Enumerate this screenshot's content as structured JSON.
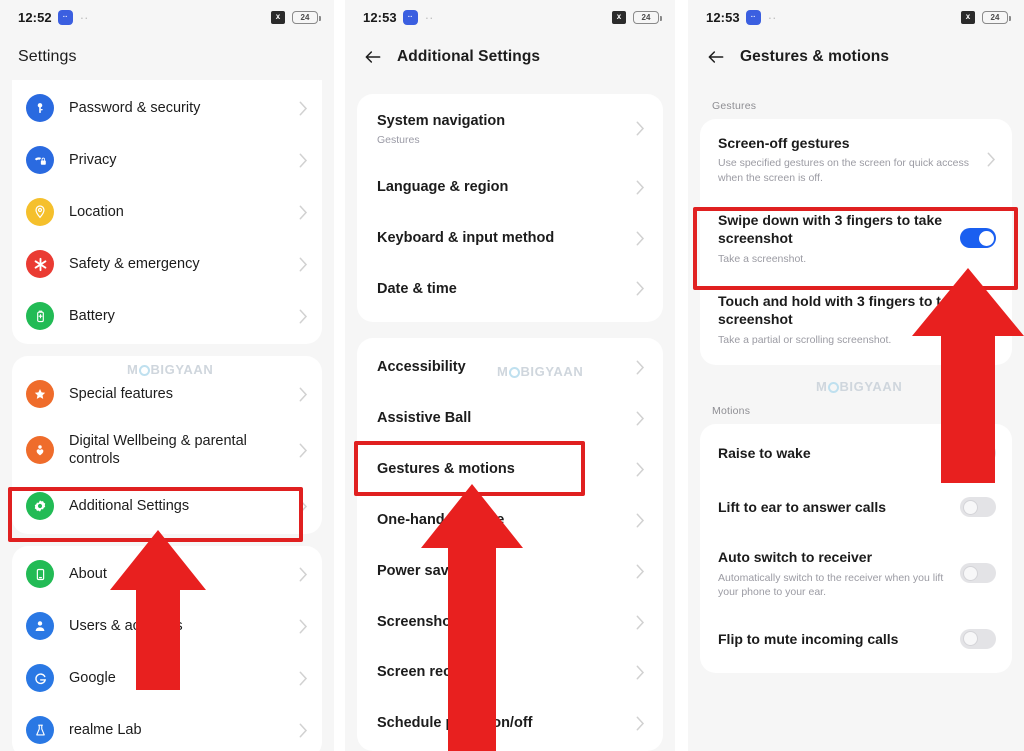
{
  "meta": {
    "watermark_text_parts": [
      "M",
      "BIGYAAN"
    ],
    "accent_red": "#e02020",
    "toggle_on_color": "#1a5ff0"
  },
  "panel1": {
    "status": {
      "time": "12:52",
      "badge_glyph": "··",
      "dash": "··",
      "silent_icon": "x",
      "battery": "24"
    },
    "title": "Settings",
    "group1": [
      {
        "label": "Password & security",
        "icon": "key-icon",
        "color": "#2a6ae0"
      },
      {
        "label": "Privacy",
        "icon": "privacy-hand-icon",
        "color": "#2a6ae0"
      },
      {
        "label": "Location",
        "icon": "location-pin-icon",
        "color": "#f5c02c"
      },
      {
        "label": "Safety & emergency",
        "icon": "asterisk-sos-icon",
        "color": "#ea3b33"
      },
      {
        "label": "Battery",
        "icon": "battery-icon",
        "color": "#22bb55"
      }
    ],
    "group2": [
      {
        "label": "Special features",
        "icon": "star-icon",
        "color": "#ef6c2b"
      },
      {
        "label": "Digital Wellbeing & parental controls",
        "icon": "wellbeing-person-icon",
        "color": "#ef6c2b"
      },
      {
        "label": "Additional Settings",
        "icon": "gear-icon",
        "color": "#22bb55"
      }
    ],
    "group3": [
      {
        "label": "About",
        "icon": "phone-icon",
        "color": "#22bb55"
      },
      {
        "label": "Users & accounts",
        "icon": "person-icon",
        "color": "#2a78e4"
      },
      {
        "label": "Google",
        "icon": "google-g-icon",
        "color": "#2a78e4"
      },
      {
        "label": "realme Lab",
        "icon": "lab-icon",
        "color": "#2a78e4"
      }
    ]
  },
  "panel2": {
    "status": {
      "time": "12:53",
      "badge_glyph": "··",
      "dash": "··",
      "silent_icon": "x",
      "battery": "24"
    },
    "title": "Additional Settings",
    "back_icon": "back-arrow-icon",
    "group1": [
      {
        "title": "System navigation",
        "sub": "Gestures"
      },
      {
        "title": "Language & region",
        "sub": ""
      },
      {
        "title": "Keyboard & input method",
        "sub": ""
      },
      {
        "title": "Date & time",
        "sub": ""
      }
    ],
    "group2": [
      {
        "title": "Accessibility",
        "sub": ""
      },
      {
        "title": "Assistive Ball",
        "sub": ""
      },
      {
        "title": "Gestures & motions",
        "sub": ""
      },
      {
        "title": "One-handed mode",
        "sub": ""
      },
      {
        "title": "Power saving",
        "sub": ""
      },
      {
        "title": "Screenshot",
        "sub": ""
      },
      {
        "title": "Screen recording",
        "sub": ""
      },
      {
        "title": "Schedule power on/off",
        "sub": ""
      }
    ]
  },
  "panel3": {
    "status": {
      "time": "12:53",
      "badge_glyph": "··",
      "dash": "··",
      "silent_icon": "x",
      "battery": "24"
    },
    "title": "Gestures & motions",
    "back_icon": "back-arrow-icon",
    "section_gestures": "Gestures",
    "section_motions": "Motions",
    "gestures": [
      {
        "title": "Screen-off gestures",
        "sub": "Use specified gestures on the screen for quick access when the screen is off.",
        "control": "chevron"
      },
      {
        "title": "Swipe down with 3 fingers to take screenshot",
        "sub": "Take a screenshot.",
        "control": "toggle",
        "toggle_state": "on"
      },
      {
        "title": "Touch and hold with 3 fingers to take screenshot",
        "sub": "Take a partial or scrolling screenshot.",
        "control": "none"
      }
    ],
    "motions": [
      {
        "title": "Raise to wake",
        "sub": "",
        "toggle_state": "off"
      },
      {
        "title": "Lift to ear to answer calls",
        "sub": "",
        "toggle_state": "off"
      },
      {
        "title": "Auto switch to receiver",
        "sub": "Automatically switch to the receiver when you lift your phone to your ear.",
        "toggle_state": "off"
      },
      {
        "title": "Flip to mute incoming calls",
        "sub": "",
        "toggle_state": "off"
      }
    ]
  }
}
